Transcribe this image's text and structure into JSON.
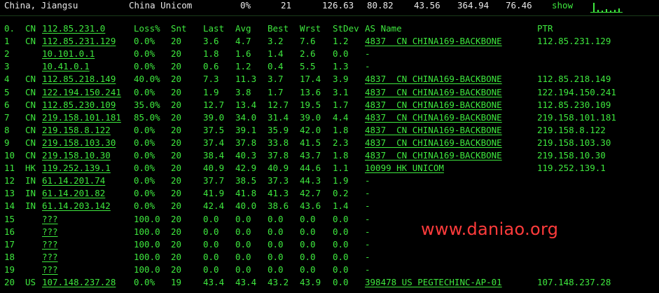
{
  "summary": {
    "location": "China, Jiangsu",
    "isp": "China Unicom",
    "loss": "0%",
    "sent": "21",
    "last": "126.63",
    "avg": "80.82",
    "best": "43.56",
    "worst": "364.94",
    "stdev": "76.46",
    "show_label": "show",
    "sparkline_icon": "latency-sparkline-icon"
  },
  "headers": {
    "hop": "0.",
    "cc": "CN",
    "host": "112.85.231.0",
    "loss": "Loss%",
    "snt": "Snt",
    "last": "Last",
    "avg": "Avg",
    "best": "Best",
    "wrst": "Wrst",
    "stdev": "StDev",
    "as": "AS Name",
    "ptr": "PTR"
  },
  "hops": [
    {
      "hop": "1",
      "cc": "CN",
      "host": "112.85.231.129",
      "loss": "0.0%",
      "snt": "20",
      "last": "3.6",
      "avg": "4.7",
      "best": "3.2",
      "wrst": "7.6",
      "stdev": "1.2",
      "as": "4837  CN CHINA169-BACKBONE",
      "ptr": "112.85.231.129"
    },
    {
      "hop": "2",
      "cc": "",
      "host": "10.101.0.1",
      "loss": "0.0%",
      "snt": "20",
      "last": "1.8",
      "avg": "1.6",
      "best": "1.4",
      "wrst": "2.6",
      "stdev": "0.0",
      "as": "-",
      "ptr": ""
    },
    {
      "hop": "3",
      "cc": "",
      "host": "10.41.0.1",
      "loss": "0.0%",
      "snt": "20",
      "last": "0.6",
      "avg": "1.2",
      "best": "0.4",
      "wrst": "5.5",
      "stdev": "1.3",
      "as": "-",
      "ptr": ""
    },
    {
      "hop": "4",
      "cc": "CN",
      "host": "112.85.218.149",
      "loss": "40.0%",
      "snt": "20",
      "last": "7.3",
      "avg": "11.3",
      "best": "3.7",
      "wrst": "17.4",
      "stdev": "3.9",
      "as": "4837  CN CHINA169-BACKBONE",
      "ptr": "112.85.218.149"
    },
    {
      "hop": "5",
      "cc": "CN",
      "host": "122.194.150.241",
      "loss": "0.0%",
      "snt": "20",
      "last": "1.9",
      "avg": "3.8",
      "best": "1.7",
      "wrst": "13.6",
      "stdev": "3.1",
      "as": "4837  CN CHINA169-BACKBONE",
      "ptr": "122.194.150.241"
    },
    {
      "hop": "6",
      "cc": "CN",
      "host": "112.85.230.109",
      "loss": "35.0%",
      "snt": "20",
      "last": "12.7",
      "avg": "13.4",
      "best": "12.7",
      "wrst": "19.5",
      "stdev": "1.7",
      "as": "4837  CN CHINA169-BACKBONE",
      "ptr": "112.85.230.109"
    },
    {
      "hop": "7",
      "cc": "CN",
      "host": "219.158.101.181",
      "loss": "85.0%",
      "snt": "20",
      "last": "39.0",
      "avg": "34.0",
      "best": "31.4",
      "wrst": "39.0",
      "stdev": "4.4",
      "as": "4837  CN CHINA169-BACKBONE",
      "ptr": "219.158.101.181"
    },
    {
      "hop": "8",
      "cc": "CN",
      "host": "219.158.8.122",
      "loss": "0.0%",
      "snt": "20",
      "last": "37.5",
      "avg": "39.1",
      "best": "35.9",
      "wrst": "42.0",
      "stdev": "1.8",
      "as": "4837  CN CHINA169-BACKBONE",
      "ptr": "219.158.8.122"
    },
    {
      "hop": "9",
      "cc": "CN",
      "host": "219.158.103.30",
      "loss": "0.0%",
      "snt": "20",
      "last": "37.4",
      "avg": "37.8",
      "best": "33.8",
      "wrst": "41.5",
      "stdev": "2.3",
      "as": "4837  CN CHINA169-BACKBONE",
      "ptr": "219.158.103.30"
    },
    {
      "hop": "10",
      "cc": "CN",
      "host": "219.158.10.30",
      "loss": "0.0%",
      "snt": "20",
      "last": "38.4",
      "avg": "40.3",
      "best": "37.8",
      "wrst": "43.7",
      "stdev": "1.8",
      "as": "4837  CN CHINA169-BACKBONE",
      "ptr": "219.158.10.30"
    },
    {
      "hop": "11",
      "cc": "HK",
      "host": "119.252.139.1",
      "loss": "0.0%",
      "snt": "20",
      "last": "40.9",
      "avg": "42.9",
      "best": "40.9",
      "wrst": "44.6",
      "stdev": "1.1",
      "as": "10099 HK UNICOM",
      "ptr": "119.252.139.1"
    },
    {
      "hop": "12",
      "cc": "IN",
      "host": "61.14.201.74",
      "loss": "0.0%",
      "snt": "20",
      "last": "37.7",
      "avg": "38.5",
      "best": "37.3",
      "wrst": "44.3",
      "stdev": "1.9",
      "as": "-",
      "ptr": ""
    },
    {
      "hop": "13",
      "cc": "IN",
      "host": "61.14.201.82",
      "loss": "0.0%",
      "snt": "20",
      "last": "41.9",
      "avg": "41.8",
      "best": "41.3",
      "wrst": "42.7",
      "stdev": "0.2",
      "as": "-",
      "ptr": ""
    },
    {
      "hop": "14",
      "cc": "IN",
      "host": "61.14.203.142",
      "loss": "0.0%",
      "snt": "20",
      "last": "42.4",
      "avg": "40.0",
      "best": "38.6",
      "wrst": "43.6",
      "stdev": "1.4",
      "as": "-",
      "ptr": ""
    },
    {
      "hop": "15",
      "cc": "",
      "host": "???",
      "loss": "100.0",
      "snt": "20",
      "last": "0.0",
      "avg": "0.0",
      "best": "0.0",
      "wrst": "0.0",
      "stdev": "0.0",
      "as": "-",
      "ptr": ""
    },
    {
      "hop": "16",
      "cc": "",
      "host": "???",
      "loss": "100.0",
      "snt": "20",
      "last": "0.0",
      "avg": "0.0",
      "best": "0.0",
      "wrst": "0.0",
      "stdev": "0.0",
      "as": "-",
      "ptr": ""
    },
    {
      "hop": "17",
      "cc": "",
      "host": "???",
      "loss": "100.0",
      "snt": "20",
      "last": "0.0",
      "avg": "0.0",
      "best": "0.0",
      "wrst": "0.0",
      "stdev": "0.0",
      "as": "-",
      "ptr": ""
    },
    {
      "hop": "18",
      "cc": "",
      "host": "???",
      "loss": "100.0",
      "snt": "20",
      "last": "0.0",
      "avg": "0.0",
      "best": "0.0",
      "wrst": "0.0",
      "stdev": "0.0",
      "as": "-",
      "ptr": ""
    },
    {
      "hop": "19",
      "cc": "",
      "host": "???",
      "loss": "100.0",
      "snt": "20",
      "last": "0.0",
      "avg": "0.0",
      "best": "0.0",
      "wrst": "0.0",
      "stdev": "0.0",
      "as": "-",
      "ptr": ""
    },
    {
      "hop": "20",
      "cc": "US",
      "host": "107.148.237.28",
      "loss": "0.0%",
      "snt": "19",
      "last": "43.4",
      "avg": "43.4",
      "best": "43.2",
      "wrst": "43.9",
      "stdev": "0.0",
      "as": "398478 US PEGTECHINC-AP-01",
      "ptr": "107.148.237.28"
    }
  ],
  "watermark": "www.daniao.org",
  "colors": {
    "text": "#3ee83e",
    "summary_text": "#e8e8e8",
    "watermark": "#ff3b3b",
    "background": "#000000"
  }
}
